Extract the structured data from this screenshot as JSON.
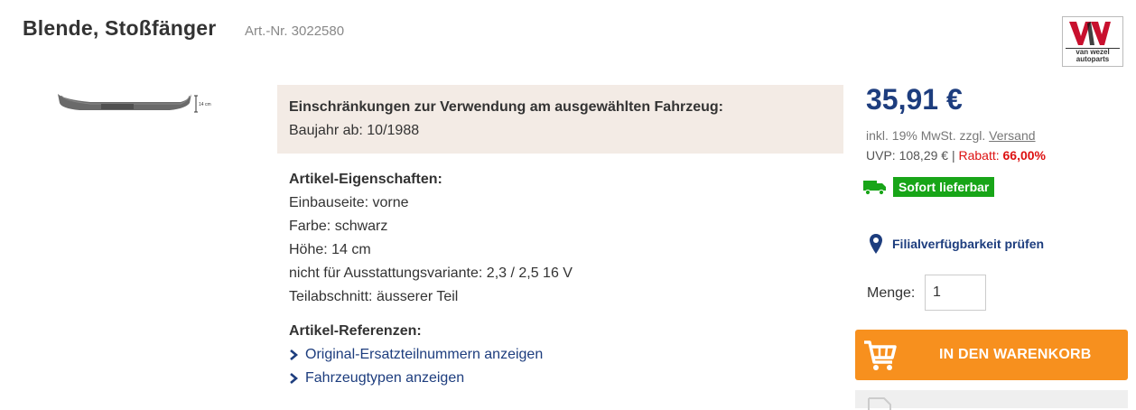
{
  "product": {
    "title": "Blende, Stoßfänger",
    "art_nr": "Art.-Nr. 3022580"
  },
  "logo": {
    "mark": "V.W.",
    "text_line1": "van wezel",
    "text_line2": "autoparts"
  },
  "image": {
    "dimension_label": "14 cm"
  },
  "restrictions": {
    "heading": "Einschränkungen zur Verwendung am ausgewählten Fahrzeug:",
    "value": "Baujahr ab: 10/1988"
  },
  "properties": {
    "heading": "Artikel-Eigenschaften:",
    "items": [
      "Einbauseite: vorne",
      "Farbe: schwarz",
      "Höhe: 14 cm",
      "nicht für Ausstattungsvariante: 2,3 / 2,5 16 V",
      "Teilabschnitt: äusserer Teil"
    ]
  },
  "references": {
    "heading": "Artikel-Referenzen:",
    "links": [
      "Original-Ersatzteilnummern anzeigen",
      "Fahrzeugtypen anzeigen"
    ]
  },
  "pricing": {
    "price": "35,91 €",
    "tax_prefix": "inkl. 19% MwSt. zzgl.",
    "shipping_link": "Versand",
    "uvp_label": "UVP: 108,29 €",
    "separator": "|",
    "rabatt_label": "Rabatt:",
    "rabatt_value": "66,00%"
  },
  "availability": {
    "badge": "Sofort lieferbar",
    "badge_color": "#18a518"
  },
  "branch": {
    "label": "Filialverfügbarkeit prüfen"
  },
  "quantity": {
    "label": "Menge:",
    "value": "1"
  },
  "cart": {
    "label": "IN DEN WARENKORB",
    "color": "#f7901e"
  },
  "colors": {
    "accent": "#1d3d7e",
    "discount": "#dd1111"
  }
}
